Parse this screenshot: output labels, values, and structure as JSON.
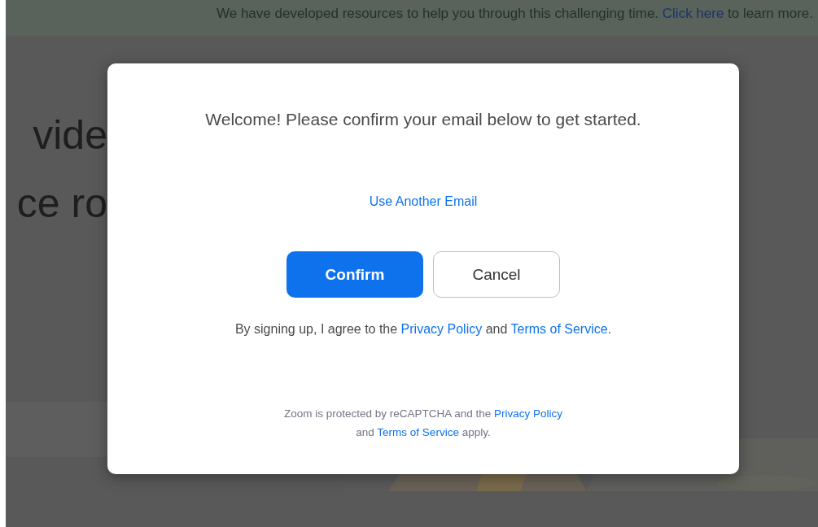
{
  "banner": {
    "segments": [
      {
        "kind": "text",
        "text": "We have developed resources to help you through this challenging time. "
      },
      {
        "kind": "link",
        "text": "Click here"
      },
      {
        "kind": "text",
        "text": " to learn more."
      }
    ]
  },
  "hero": {
    "lines": [
      "vide",
      "ce ro"
    ]
  },
  "dialog": {
    "title": "Welcome! Please confirm your email below to get started.",
    "switch_link": "Use Another Email",
    "buttons": [
      {
        "label": "Confirm",
        "kind": "primary"
      },
      {
        "label": "Cancel",
        "kind": "secondary"
      }
    ],
    "agreement": [
      {
        "kind": "text",
        "text": "By signing up, I agree to the "
      },
      {
        "kind": "link",
        "text": "Privacy Policy"
      },
      {
        "kind": "text",
        "text": " and "
      },
      {
        "kind": "link",
        "text": "Terms of Service"
      },
      {
        "kind": "text",
        "text": "."
      }
    ],
    "recaptcha": [
      {
        "kind": "text",
        "text": "Zoom is protected by reCAPTCHA and the "
      },
      {
        "kind": "link",
        "text": "Privacy Policy"
      },
      {
        "kind": "break"
      },
      {
        "kind": "text",
        "text": "and "
      },
      {
        "kind": "link",
        "text": "Terms of Service"
      },
      {
        "kind": "text",
        "text": " apply."
      }
    ]
  }
}
